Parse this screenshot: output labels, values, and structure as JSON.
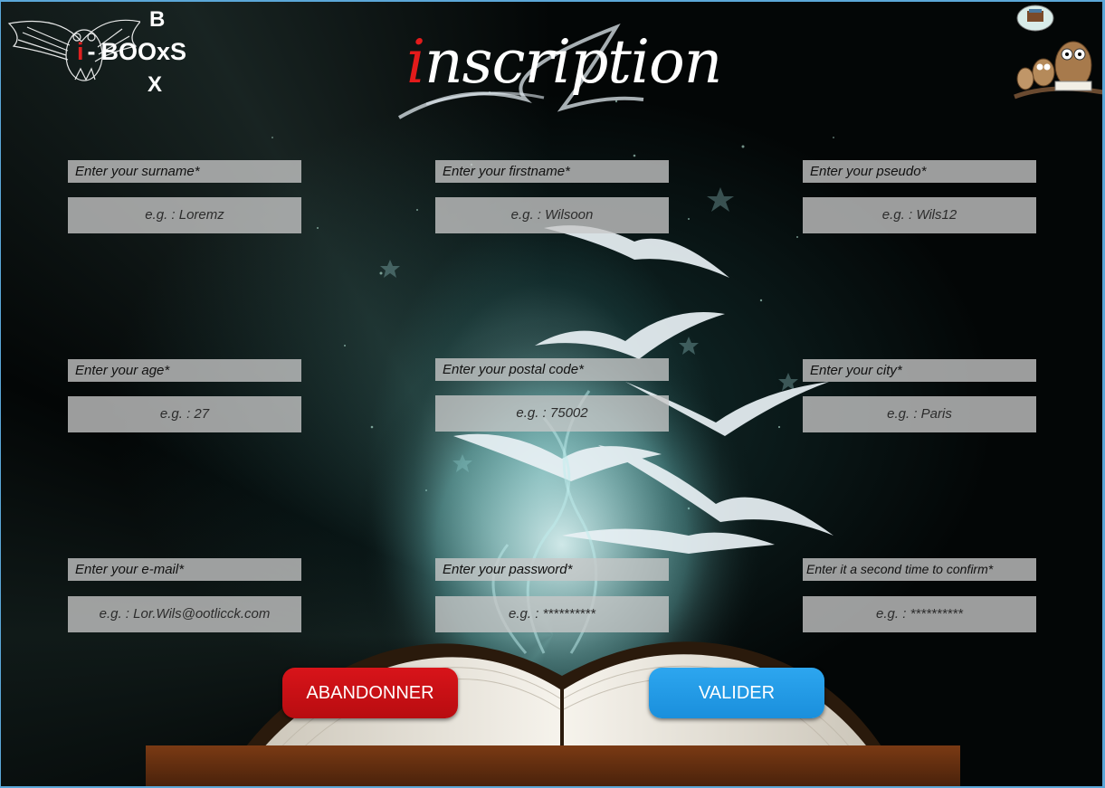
{
  "logo": {
    "top_letter": "B",
    "middle_prefix": "i",
    "middle_dash": "-",
    "middle_word": "BOOxS",
    "bottom_letter": "X"
  },
  "page": {
    "title_first_letter": "i",
    "title_rest": "nscription"
  },
  "form": {
    "surname": {
      "label": "Enter your surname*",
      "placeholder": "e.g. : Loremz"
    },
    "firstname": {
      "label": "Enter your firstname*",
      "placeholder": "e.g. : Wilsoon"
    },
    "pseudo": {
      "label": "Enter your pseudo*",
      "placeholder": "e.g. : Wils12"
    },
    "age": {
      "label": "Enter your age*",
      "placeholder": "e.g. : 27"
    },
    "postal_code": {
      "label": "Enter your postal code*",
      "placeholder": "e.g. : 75002"
    },
    "city": {
      "label": "Enter your city*",
      "placeholder": "e.g. : Paris"
    },
    "email": {
      "label": "Enter your e-mail*",
      "placeholder": "e.g. : Lor.Wils@ootlicck.com"
    },
    "password": {
      "label": "Enter your password*",
      "placeholder": "e.g. : **********"
    },
    "password_confirm": {
      "label": "Enter it a second time to confirm*",
      "placeholder": "e.g. : **********"
    }
  },
  "buttons": {
    "cancel": "ABANDONNER",
    "validate": "VALIDER"
  },
  "colors": {
    "cancel_button": "#d8141a",
    "validate_button": "#2da6ef",
    "title_accent": "#e31b1b",
    "frame_border": "#5ba7d8"
  }
}
